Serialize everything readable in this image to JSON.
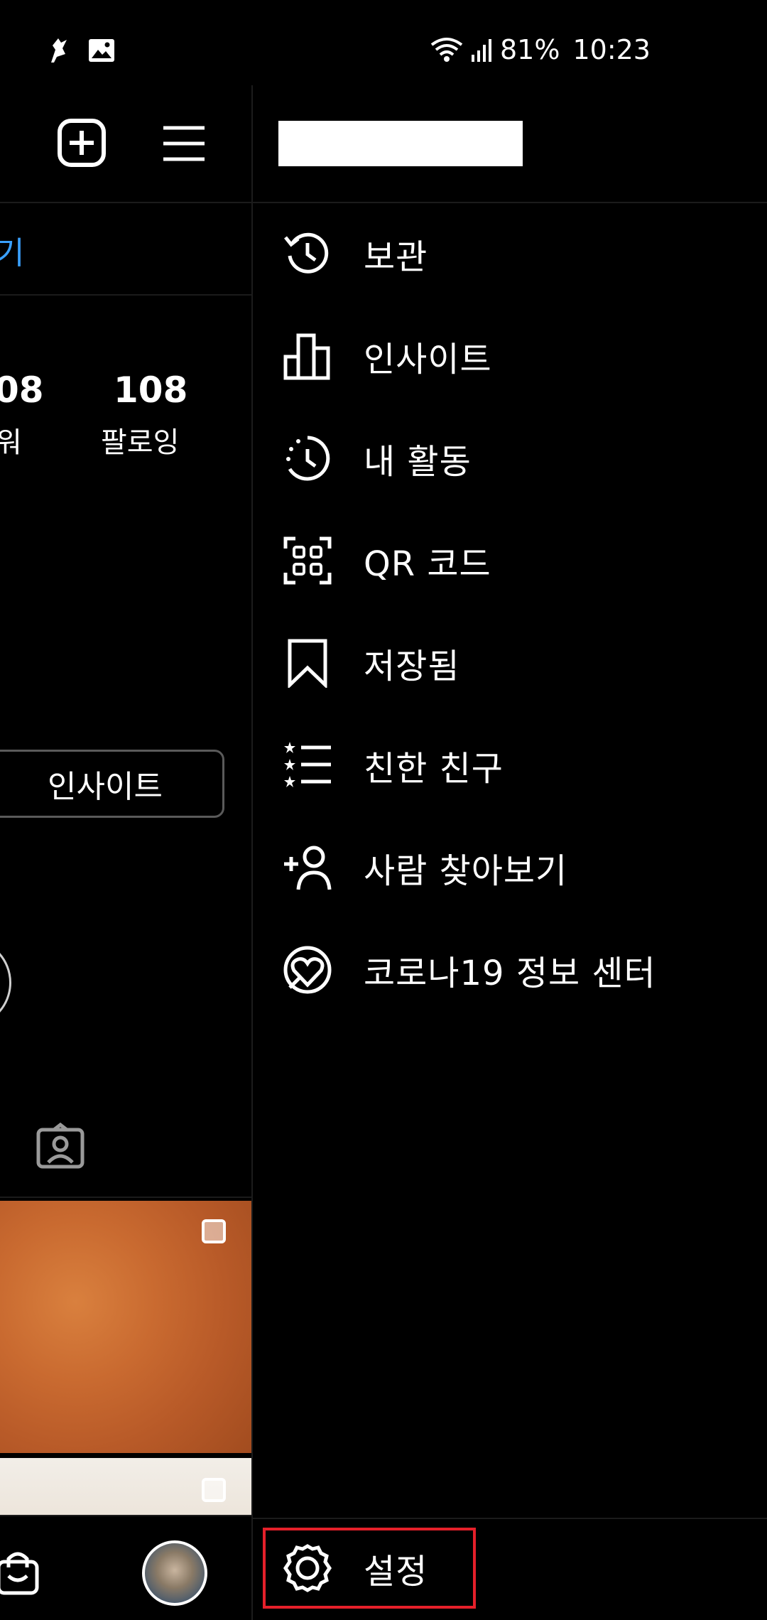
{
  "status_bar": {
    "battery": "81%",
    "time": "10:23",
    "icons": [
      "notification-icon",
      "gallery-icon",
      "wifi-icon",
      "signal-icon"
    ]
  },
  "profile": {
    "link_fragment": "기",
    "stats": [
      {
        "number": "08",
        "label": "워"
      },
      {
        "number": "108",
        "label": "팔로잉"
      }
    ],
    "insight_button": "인사이트",
    "link_color": "#3aa0ff"
  },
  "drawer": {
    "menu": [
      {
        "label": "보관",
        "icon": "archive-icon"
      },
      {
        "label": "인사이트",
        "icon": "insights-icon"
      },
      {
        "label": "내 활동",
        "icon": "activity-icon"
      },
      {
        "label": "QR 코드",
        "icon": "qr-code-icon"
      },
      {
        "label": "저장됨",
        "icon": "bookmark-icon"
      },
      {
        "label": "친한 친구",
        "icon": "close-friends-icon"
      },
      {
        "label": "사람 찾아보기",
        "icon": "discover-people-icon"
      },
      {
        "label": "코로나19 정보 센터",
        "icon": "covid-info-icon"
      }
    ],
    "settings": {
      "label": "설정",
      "icon": "settings-icon"
    },
    "highlight_color": "#e5202a"
  }
}
